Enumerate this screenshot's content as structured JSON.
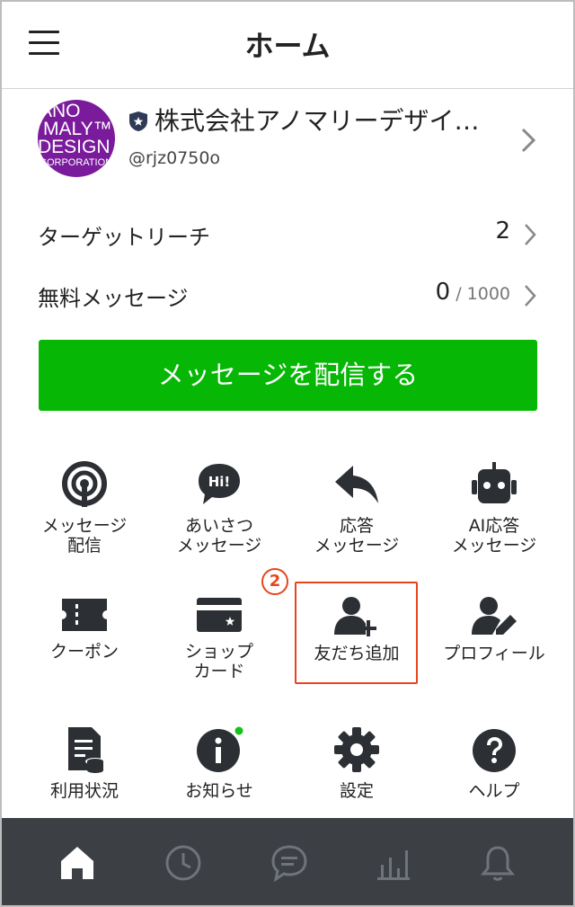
{
  "header": {
    "title": "ホーム"
  },
  "account": {
    "avatar_lines": [
      "ANO",
      "MALY™",
      "DESIGN",
      "CORPORATION"
    ],
    "name": "株式会社アノマリーデザイ…",
    "id": "@rjz0750o"
  },
  "stats": {
    "target_reach": {
      "label": "ターゲットリーチ",
      "value": "2"
    },
    "free_messages": {
      "label": "無料メッセージ",
      "value": "0",
      "limit": " / 1000"
    }
  },
  "cta_label": "メッセージを配信する",
  "step_number": "2",
  "grid": [
    {
      "icon": "broadcast-icon",
      "line1": "メッセージ",
      "line2": "配信"
    },
    {
      "icon": "greeting-icon",
      "line1": "あいさつ",
      "line2": "メッセージ",
      "icon_text": "Hi!"
    },
    {
      "icon": "reply-icon",
      "line1": "応答",
      "line2": "メッセージ"
    },
    {
      "icon": "robot-icon",
      "line1": "AI応答",
      "line2": "メッセージ"
    },
    {
      "icon": "coupon-icon",
      "line1": "クーポン",
      "line2": ""
    },
    {
      "icon": "card-icon",
      "line1": "ショップ",
      "line2": "カード"
    },
    {
      "icon": "add-friend-icon",
      "line1": "友だち追加",
      "line2": ""
    },
    {
      "icon": "profile-icon",
      "line1": "プロフィール",
      "line2": ""
    },
    {
      "icon": "usage-icon",
      "line1": "利用状況",
      "line2": ""
    },
    {
      "icon": "info-icon",
      "line1": "お知らせ",
      "line2": ""
    },
    {
      "icon": "settings-icon",
      "line1": "設定",
      "line2": ""
    },
    {
      "icon": "help-icon",
      "line1": "ヘルプ",
      "line2": ""
    }
  ],
  "tabs": [
    "home-icon",
    "clock-icon",
    "chat-icon",
    "chart-icon",
    "bell-icon"
  ],
  "colors": {
    "brand_green": "#06b706",
    "highlight": "#e6461e",
    "tabbar": "#3c3f44",
    "icon": "#2c2f33"
  }
}
